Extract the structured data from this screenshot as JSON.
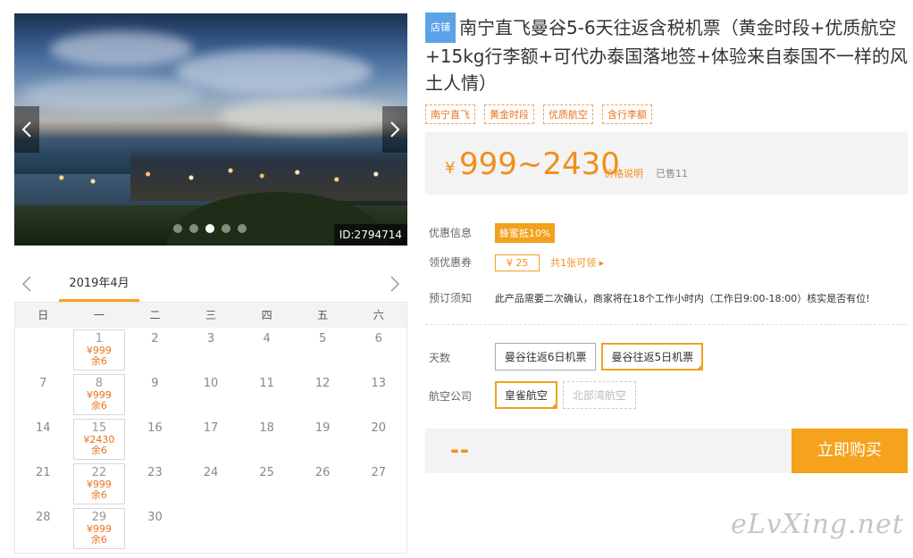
{
  "gallery": {
    "photo_id": "ID:2794714",
    "dots_count": 5,
    "active_dot": 2
  },
  "calendar": {
    "month": "2019年4月",
    "weekdays": [
      "日",
      "一",
      "二",
      "三",
      "四",
      "五",
      "六"
    ],
    "weeks": [
      [
        {
          "day": ""
        },
        {
          "day": "1",
          "price": "¥999",
          "stock": "余6"
        },
        {
          "day": "2"
        },
        {
          "day": "3"
        },
        {
          "day": "4"
        },
        {
          "day": "5"
        },
        {
          "day": "6"
        }
      ],
      [
        {
          "day": "7"
        },
        {
          "day": "8",
          "price": "¥999",
          "stock": "余6"
        },
        {
          "day": "9"
        },
        {
          "day": "10"
        },
        {
          "day": "11"
        },
        {
          "day": "12"
        },
        {
          "day": "13"
        }
      ],
      [
        {
          "day": "14"
        },
        {
          "day": "15",
          "price": "¥2430",
          "stock": "余6"
        },
        {
          "day": "16"
        },
        {
          "day": "17"
        },
        {
          "day": "18"
        },
        {
          "day": "19"
        },
        {
          "day": "20"
        }
      ],
      [
        {
          "day": "21"
        },
        {
          "day": "22",
          "price": "¥999",
          "stock": "余6"
        },
        {
          "day": "23"
        },
        {
          "day": "24"
        },
        {
          "day": "25"
        },
        {
          "day": "26"
        },
        {
          "day": "27"
        }
      ],
      [
        {
          "day": "28"
        },
        {
          "day": "29",
          "price": "¥999",
          "stock": "余6"
        },
        {
          "day": "30"
        },
        {
          "day": ""
        },
        {
          "day": ""
        },
        {
          "day": ""
        },
        {
          "day": ""
        }
      ]
    ]
  },
  "product": {
    "shop_tag": "店铺",
    "title": "南宁直飞曼谷5-6天往返含税机票（黄金时段+优质航空+15kg行李额+可代办泰国落地签+体验来自泰国不一样的风土人情）",
    "tags": [
      "南宁直飞",
      "黄金时段",
      "优质航空",
      "含行李额"
    ],
    "price_symbol": "¥",
    "price_range": "999~2430",
    "price_explain": "价格说明",
    "sold": "已售11"
  },
  "info": {
    "promo_label": "优惠信息",
    "promo_badge": "蜂蜜抵10%",
    "coupon_label": "领优惠券",
    "coupon_value": "¥ 25",
    "coupon_link": "共1张可领",
    "notice_label": "预订须知",
    "notice_text": "此产品需要二次确认，商家将在18个工作小时内（工作日9:00-18:00）核实是否有位!"
  },
  "options": {
    "days_label": "天数",
    "days": [
      {
        "label": "曼谷往返6日机票",
        "selected": false
      },
      {
        "label": "曼谷往返5日机票",
        "selected": true
      }
    ],
    "airline_label": "航空公司",
    "airlines": [
      {
        "label": "皇雀航空",
        "selected": true
      },
      {
        "label": "北部湾航空",
        "disabled": true
      }
    ]
  },
  "purchase": {
    "total_placeholder": "--",
    "buy_label": "立即购买"
  },
  "watermark": "eLvXing.net",
  "colors": {
    "accent": "#f5a21d",
    "price": "#f18e1c",
    "shop_tag": "#5ba2e8"
  }
}
